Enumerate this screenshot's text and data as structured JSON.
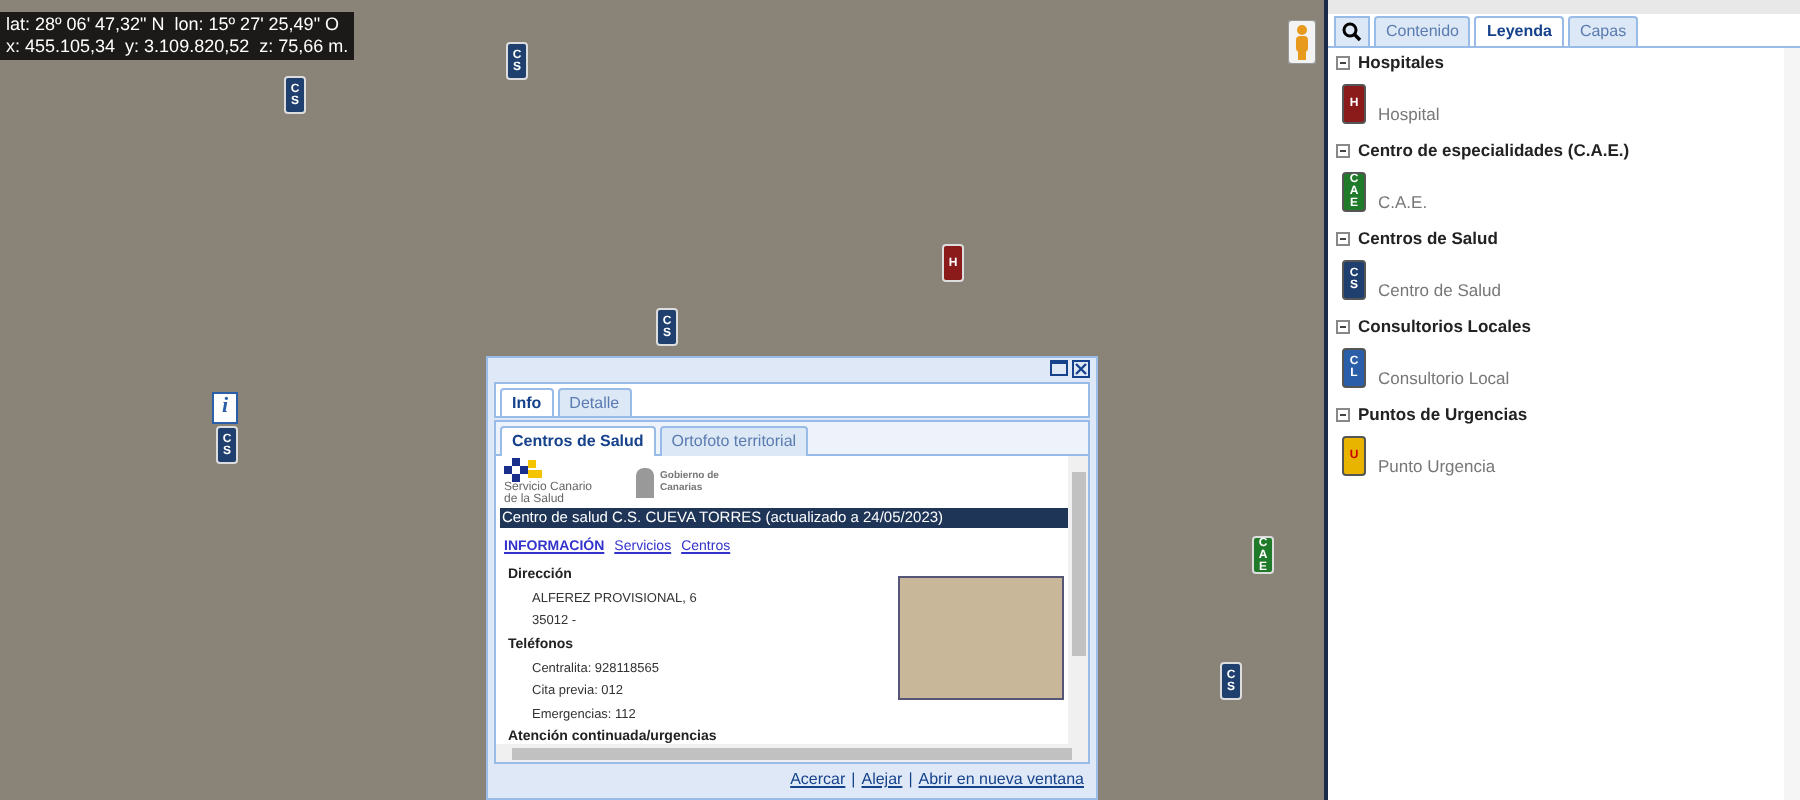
{
  "coords": {
    "line1": "lat: 28º 06' 47,32\" N  lon: 15º 27' 25,49\" O",
    "line2": "x: 455.105,34  y: 3.109.820,52  z: 75,66 m."
  },
  "map_markers": [
    {
      "text": "CS",
      "color": "#1f3f6e"
    },
    {
      "text": "CS",
      "color": "#1f3f6e"
    },
    {
      "text": "CS",
      "color": "#1f3f6e"
    },
    {
      "text": "CS",
      "color": "#1f3f6e"
    },
    {
      "text": "CS",
      "color": "#1f3f6e"
    },
    {
      "text": "H",
      "color": "#8b1a1a"
    },
    {
      "text": "CAE",
      "color": "#1f7a2a"
    }
  ],
  "info_marker": {
    "text": "i"
  },
  "popup": {
    "tabs": [
      {
        "label": "Info",
        "selected": true
      },
      {
        "label": "Detalle",
        "selected": false
      }
    ],
    "subtabs": [
      {
        "label": "Centros de Salud",
        "selected": true
      },
      {
        "label": "Ortofoto territorial",
        "selected": false
      }
    ],
    "logo1_text": "Servicio Canario de la Salud",
    "logo2_text": "Gobierno de Canarias",
    "heading": "Centro de salud C.S. CUEVA TORRES (actualizado a 24/05/2023)",
    "links": [
      {
        "label": "INFORMACIÓN",
        "selected": true
      },
      {
        "label": "Servicios",
        "selected": false
      },
      {
        "label": "Centros",
        "selected": false
      }
    ],
    "sections": [
      {
        "title": "Dirección",
        "lines": [
          "ALFEREZ PROVISIONAL, 6",
          "35012 -"
        ]
      },
      {
        "title": "Teléfonos",
        "lines": [
          "Centralita: 928118565",
          "Cita previa: 012",
          "Emergencias: 112"
        ]
      },
      {
        "title": "Atención continuada/urgencias"
      }
    ],
    "footer_links": [
      "Acercar",
      "Alejar",
      "Abrir en nueva ventana"
    ],
    "footer_separator": "|"
  },
  "panel": {
    "tabs": [
      {
        "label": "Contenido",
        "selected": false
      },
      {
        "label": "Leyenda",
        "selected": true
      },
      {
        "label": "Capas",
        "selected": false
      }
    ],
    "legend": [
      {
        "title": "Hospitales",
        "expanded": true,
        "items": [
          {
            "label": "Hospital",
            "icon_text": "H",
            "color": "#8b1a1a"
          }
        ]
      },
      {
        "title": "Centro de especialidades (C.A.E.)",
        "expanded": true,
        "items": [
          {
            "label": "C.A.E.",
            "icon_text": "CAE",
            "color": "#1f7a2a"
          }
        ]
      },
      {
        "title": "Centros de Salud",
        "expanded": true,
        "items": [
          {
            "label": "Centro de Salud",
            "icon_text": "CS",
            "color": "#1f3f6e"
          }
        ]
      },
      {
        "title": "Consultorios Locales",
        "expanded": true,
        "items": [
          {
            "label": "Consultorio Local",
            "icon_text": "CL",
            "color": "#2a5ea8"
          }
        ]
      },
      {
        "title": "Puntos de Urgencias",
        "expanded": true,
        "items": [
          {
            "label": "Punto Urgencia",
            "icon_text": "U",
            "color": "#e8b400"
          }
        ]
      }
    ]
  }
}
